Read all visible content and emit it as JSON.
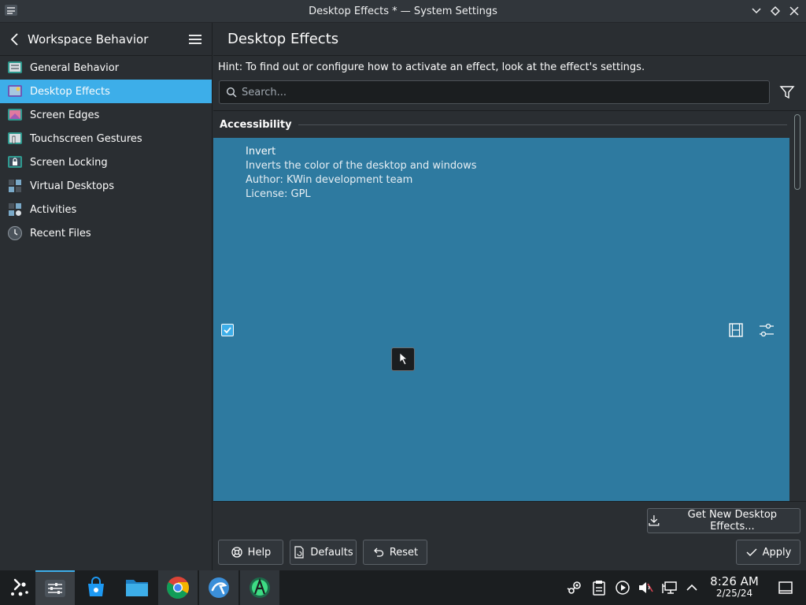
{
  "window": {
    "title": "Desktop Effects * — System Settings"
  },
  "sidebar": {
    "title": "Workspace Behavior",
    "items": [
      {
        "label": "General Behavior",
        "icon": "general-behavior-icon"
      },
      {
        "label": "Desktop Effects",
        "icon": "desktop-effects-icon",
        "active": true
      },
      {
        "label": "Screen Edges",
        "icon": "screen-edges-icon"
      },
      {
        "label": "Touchscreen Gestures",
        "icon": "touchscreen-gestures-icon"
      },
      {
        "label": "Screen Locking",
        "icon": "screen-locking-icon"
      },
      {
        "label": "Virtual Desktops",
        "icon": "virtual-desktops-icon"
      },
      {
        "label": "Activities",
        "icon": "activities-icon"
      },
      {
        "label": "Recent Files",
        "icon": "recent-files-icon"
      }
    ]
  },
  "main": {
    "title": "Desktop Effects",
    "hint": "Hint: To find out or configure how to activate an effect, look at the effect's settings.",
    "search_placeholder": "Search...",
    "section": "Accessibility",
    "effect": {
      "name": "Invert",
      "description": "Inverts the color of the desktop and windows",
      "author": "Author: KWin development team",
      "license": "License: GPL",
      "enabled": true
    },
    "get_new_label": "Get New Desktop Effects...",
    "help_label": "Help",
    "defaults_label": "Defaults",
    "reset_label": "Reset",
    "apply_label": "Apply"
  },
  "taskbar": {
    "apps": [
      "application-launcher-icon",
      "system-settings-icon",
      "discover-store-icon",
      "file-manager-icon",
      "chrome-icon",
      "app-icon",
      "android-studio-icon"
    ],
    "tray": [
      "steam-icon",
      "clipboard-icon",
      "media-player-icon",
      "volume-muted-icon",
      "network-icon",
      "tray-expand-icon"
    ],
    "time": "8:26 AM",
    "date": "2/25/24"
  },
  "colors": {
    "accent": "#3daee9",
    "selection_row": "#2e7aa0",
    "window_bg": "#2a2e32",
    "taskbar_bg": "#1b1e20"
  }
}
